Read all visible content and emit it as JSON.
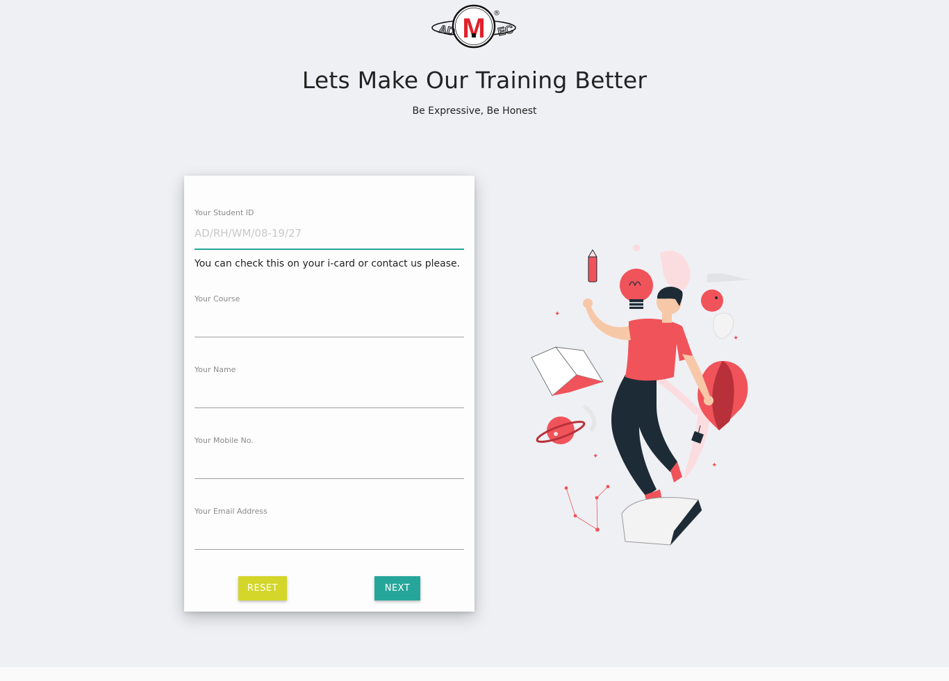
{
  "brand": {
    "logo_letter": "M",
    "logo_left_text": "AD",
    "logo_right_text": "EC",
    "registered_mark": "®",
    "accent_red": "#e0202a"
  },
  "header": {
    "title": "Lets Make Our Training Better",
    "subtitle": "Be Expressive, Be Honest"
  },
  "form": {
    "student_id": {
      "label": "Your Student ID",
      "placeholder": "AD/RH/WM/08-19/27",
      "value": "",
      "helper": "You can check this on your i-card or contact us please."
    },
    "course": {
      "label": "Your Course",
      "value": ""
    },
    "name": {
      "label": "Your Name",
      "value": ""
    },
    "mobile": {
      "label": "Your Mobile No.",
      "value": ""
    },
    "email": {
      "label": "Your Email Address",
      "value": ""
    },
    "reset_label": "RESET",
    "next_label": "NEXT"
  },
  "colors": {
    "background": "#eff0f4",
    "reset_button": "#d4d62a",
    "next_button": "#26a69a",
    "illustration_red": "#f0535a",
    "illustration_dark": "#1d2b36"
  },
  "illustration": {
    "icon": "person-juggling-ideas-illustration"
  }
}
